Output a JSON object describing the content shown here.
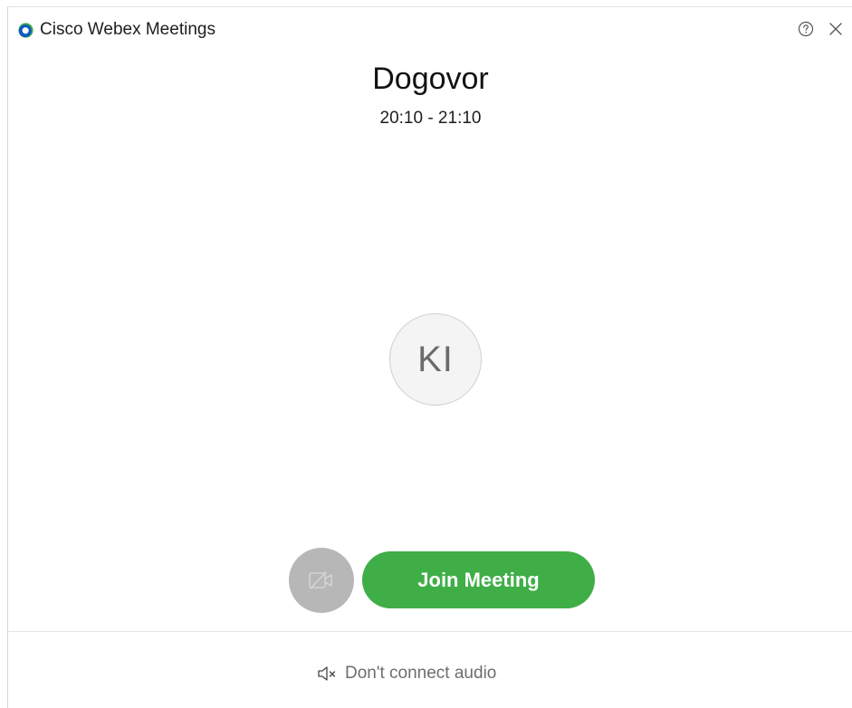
{
  "window": {
    "title": "Cisco Webex Meetings",
    "help_icon": "help-circle-icon",
    "close_icon": "close-icon"
  },
  "meeting": {
    "title": "Dogovor",
    "time": "20:10 - 21:10"
  },
  "avatar": {
    "initials": "KI"
  },
  "controls": {
    "video_icon": "video-off-icon",
    "join_label": "Join Meeting"
  },
  "audio": {
    "icon": "speaker-muted-icon",
    "label": "Don't connect audio"
  },
  "colors": {
    "join_button": "#3fae47",
    "video_button_disabled": "#b7b7b7",
    "brand_blue": "#0d5bbf",
    "brand_green": "#3fae47"
  }
}
